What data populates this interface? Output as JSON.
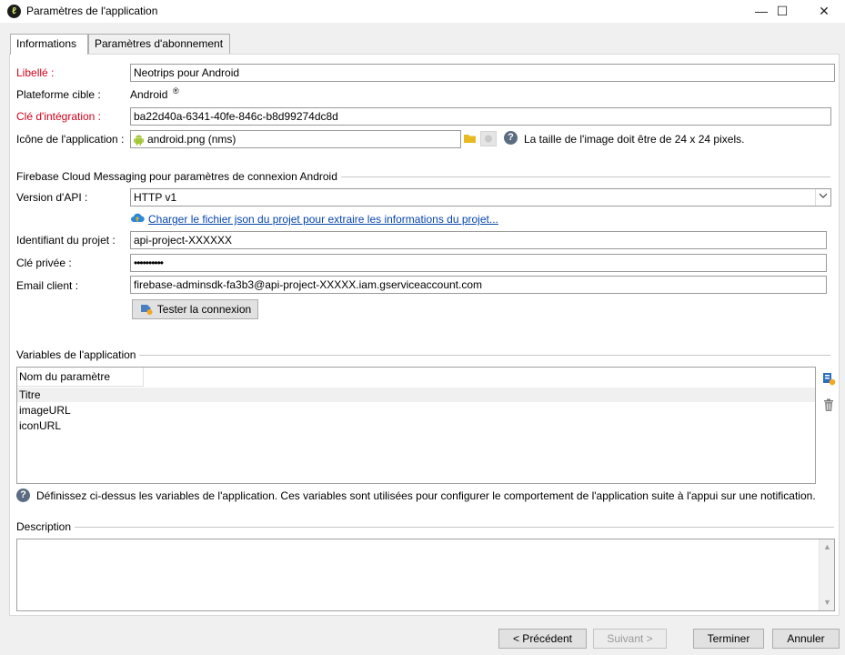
{
  "window": {
    "title": "Paramètres de l'application",
    "minimize": "—",
    "maximize": "☐",
    "close": "✕",
    "app_icon": "neolane-icon"
  },
  "tabs": [
    {
      "label": "Informations",
      "active": true
    },
    {
      "label": "Paramètres d'abonnement",
      "active": false
    }
  ],
  "form": {
    "label_libelle": "Libellé :",
    "value_libelle": "Neotrips pour Android",
    "label_platform": "Plateforme cible :",
    "value_platform": "Android",
    "platform_mark": "®",
    "label_key": "Clé d'intégration :",
    "value_key": "ba22d40a-6341-40fe-846c-b8d99274dc8d",
    "label_icon": "Icône de l'application :",
    "value_icon": "android.png (nms)",
    "icon_hint": "La taille de l'image doit être de 24 x  24 pixels."
  },
  "firebase": {
    "section_title": "Firebase Cloud Messaging pour paramètres de connexion Android",
    "label_api": "Version d'API :",
    "value_api": "HTTP v1",
    "upload_link": "Charger le fichier json du projet pour extraire les informations du projet...",
    "label_project": "Identifiant du projet :",
    "value_project": "api-project-XXXXXX",
    "label_private_key": "Clé privée :",
    "value_private_key": "••••••••••",
    "label_email": "Email client :",
    "value_email": "firebase-adminsdk-fa3b3@api-project-XXXXX.iam.gserviceaccount.com",
    "test_button": "Tester la connexion"
  },
  "variables": {
    "section_title": "Variables de l'application",
    "column_header": "Nom du paramètre",
    "rows": [
      "Titre",
      "imageURL",
      "iconURL"
    ],
    "help_text": "Définissez ci-dessus les variables de l'application. Ces variables sont utilisées pour configurer le comportement de l'application suite à l'appui sur une  notification."
  },
  "description": {
    "section_title": "Description",
    "value": ""
  },
  "footer": {
    "prev": "< Précédent",
    "next": "Suivant >",
    "finish": "Terminer",
    "cancel": "Annuler"
  },
  "colors": {
    "required_label": "#d0021b",
    "link": "#0645ad",
    "dialog_bg": "#f0f0f0",
    "android_green": "#a4c639"
  }
}
